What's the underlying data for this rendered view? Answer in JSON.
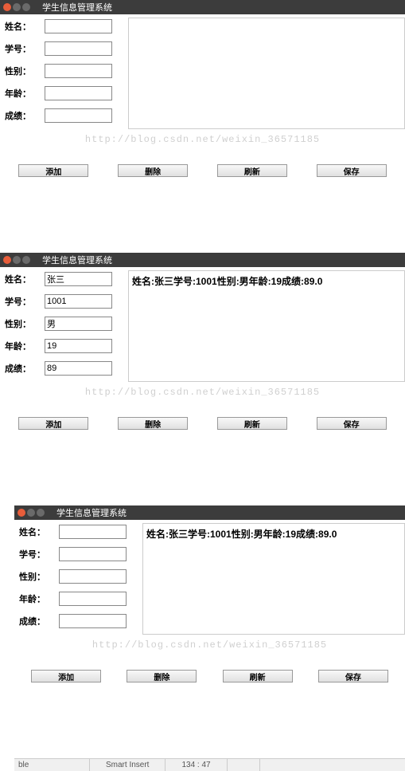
{
  "title": "学生信息管理系统",
  "labels": {
    "name": "姓名：",
    "id": "学号：",
    "gender": "性别：",
    "age": "年龄：",
    "score": "成绩："
  },
  "buttons": {
    "add": "添加",
    "delete": "删除",
    "refresh": "刷新",
    "save": "保存"
  },
  "watermark": "http://blog.csdn.net/weixin_36571185",
  "win1": {
    "name": "",
    "id": "",
    "gender": "",
    "age": "",
    "score": "",
    "display": ""
  },
  "win2": {
    "name": "张三",
    "id": "1001",
    "gender": "男",
    "age": "19",
    "score": "89",
    "display": "姓名:张三学号:1001性别:男年龄:19成绩:89.0"
  },
  "win3": {
    "name": "",
    "id": "",
    "gender": "",
    "age": "",
    "score": "",
    "display": "姓名:张三学号:1001性别:男年龄:19成绩:89.0"
  },
  "statusbar": {
    "left": "ble",
    "insert": "Smart Insert",
    "pos": "134 : 47"
  },
  "backtick": "`"
}
